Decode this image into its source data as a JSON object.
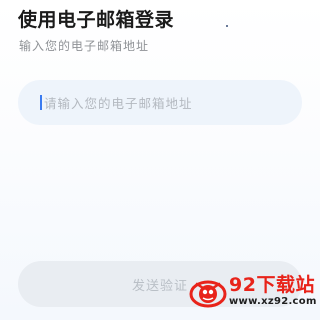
{
  "header": {
    "title": "使用电子邮箱登录",
    "subtitle": "输入您的电子邮箱地址"
  },
  "email": {
    "value": "",
    "placeholder": "请输入您的电子邮箱地址"
  },
  "send_button": {
    "label": "发送验证"
  },
  "watermark": {
    "brand": "92下载站",
    "url": "www.xz92.com"
  },
  "colors": {
    "field_bg": "#eef4fb",
    "button_bg": "#e9edf2",
    "caret": "#3a7bf0",
    "watermark_red": "#e8231a"
  }
}
